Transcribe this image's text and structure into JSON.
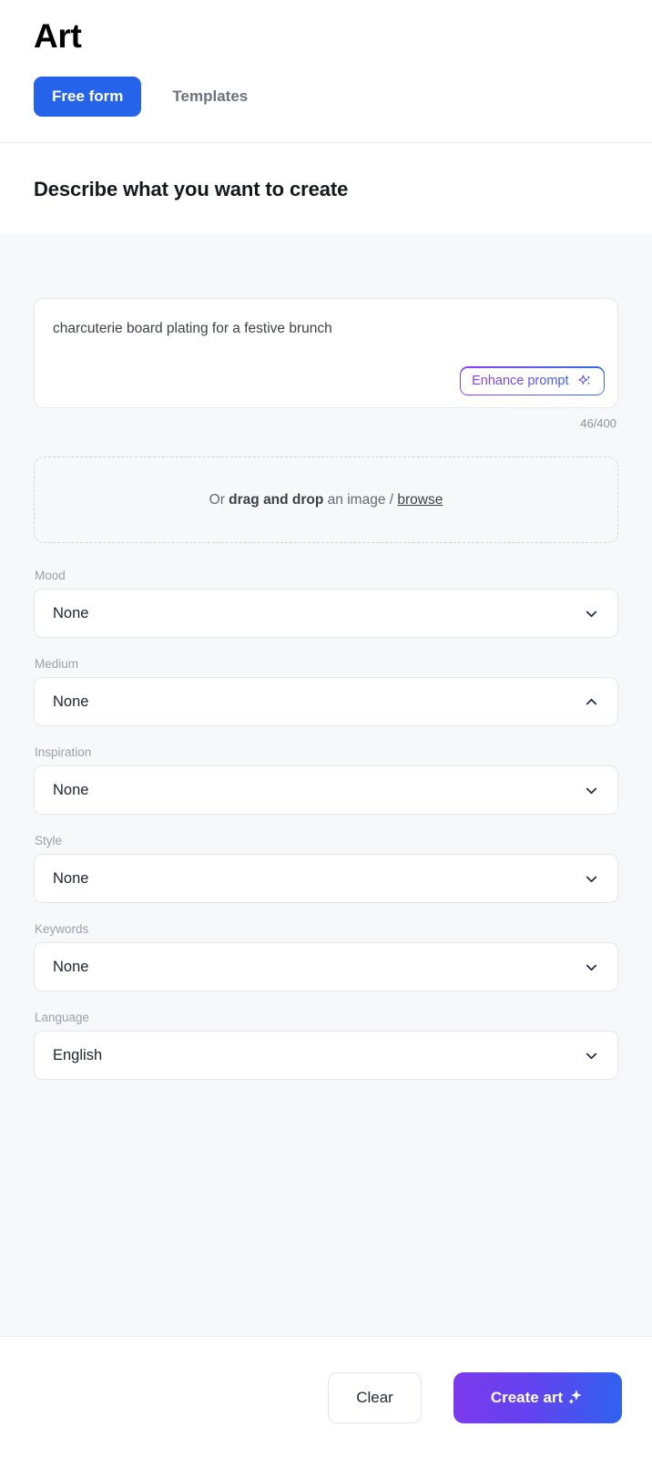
{
  "header": {
    "title": "Art",
    "tabs": [
      {
        "label": "Free form",
        "active": true,
        "name": "tab-free-form"
      },
      {
        "label": "Templates",
        "active": false,
        "name": "tab-templates"
      }
    ]
  },
  "section": {
    "heading": "Describe what you want to create"
  },
  "prompt": {
    "value": "charcuterie board plating for a festive brunch",
    "placeholder": "Describe what you want to create",
    "enhance_label": "Enhance prompt",
    "enhance_icon": "sparkles-icon",
    "char_count": "46/400"
  },
  "dropzone": {
    "prefix": "Or ",
    "bold": "drag and drop",
    "middle": " an image / ",
    "link": "browse",
    "icon": "upload-dropzone"
  },
  "fields": [
    {
      "label": "Mood",
      "value": "None",
      "chevron": "chevron-down-icon",
      "name": "select-mood"
    },
    {
      "label": "Medium",
      "value": "None",
      "chevron": "chevron-up-icon",
      "name": "select-medium"
    },
    {
      "label": "Inspiration",
      "value": "None",
      "chevron": "chevron-down-icon",
      "name": "select-inspiration"
    },
    {
      "label": "Style",
      "value": "None",
      "chevron": "chevron-down-icon",
      "name": "select-style"
    },
    {
      "label": "Keywords",
      "value": "None",
      "chevron": "chevron-down-icon",
      "name": "select-keywords"
    },
    {
      "label": "Language",
      "value": "English",
      "chevron": "chevron-down-icon",
      "name": "select-language"
    }
  ],
  "footer": {
    "clear_label": "Clear",
    "create_label": "Create art",
    "create_icon": "sparkle-icon"
  },
  "colors": {
    "accent_blue": "#2563eb",
    "gradient_start": "#7c3aed",
    "gradient_end": "#2563eb",
    "page_bg": "#f7f8fa",
    "panel_bg": "#ffffff",
    "border": "#e5e7eb",
    "muted_text": "#9aa1ac"
  }
}
